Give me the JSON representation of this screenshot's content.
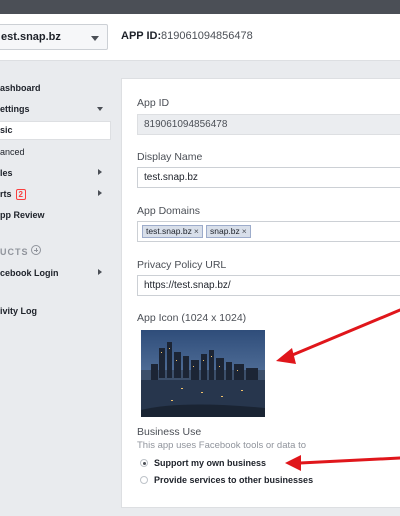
{
  "header": {
    "app_select": "est.snap.bz",
    "app_id_label": "APP ID:",
    "app_id_value": "819061094856478"
  },
  "sidebar": {
    "dashboard": "ashboard",
    "settings": "ettings",
    "basic": "sic",
    "advanced": "anced",
    "roles": "les",
    "alerts": "rts",
    "alerts_badge": "2",
    "app_review": "pp Review",
    "products_label": "UCTS",
    "facebook_login": "cebook Login",
    "activity_log": "ivity Log"
  },
  "form": {
    "app_id_label": "App ID",
    "app_id_value": "819061094856478",
    "display_name_label": "Display Name",
    "display_name_value": "test.snap.bz",
    "app_domains_label": "App Domains",
    "app_domains": [
      "test.snap.bz",
      "snap.bz"
    ],
    "privacy_label": "Privacy Policy URL",
    "privacy_value": "https://test.snap.bz/",
    "app_icon_label": "App Icon (1024 x 1024)",
    "business_use_label": "Business Use",
    "business_use_desc": "This app uses Facebook tools or data to",
    "options": [
      "Support my own business",
      "Provide services to other businesses"
    ]
  },
  "colors": {
    "arrow": "#e0161b",
    "accent": "#4267b2"
  },
  "icons": {
    "select_caret": "caret-down-icon",
    "add_product": "plus-circle-icon",
    "tag_remove": "close-icon"
  }
}
